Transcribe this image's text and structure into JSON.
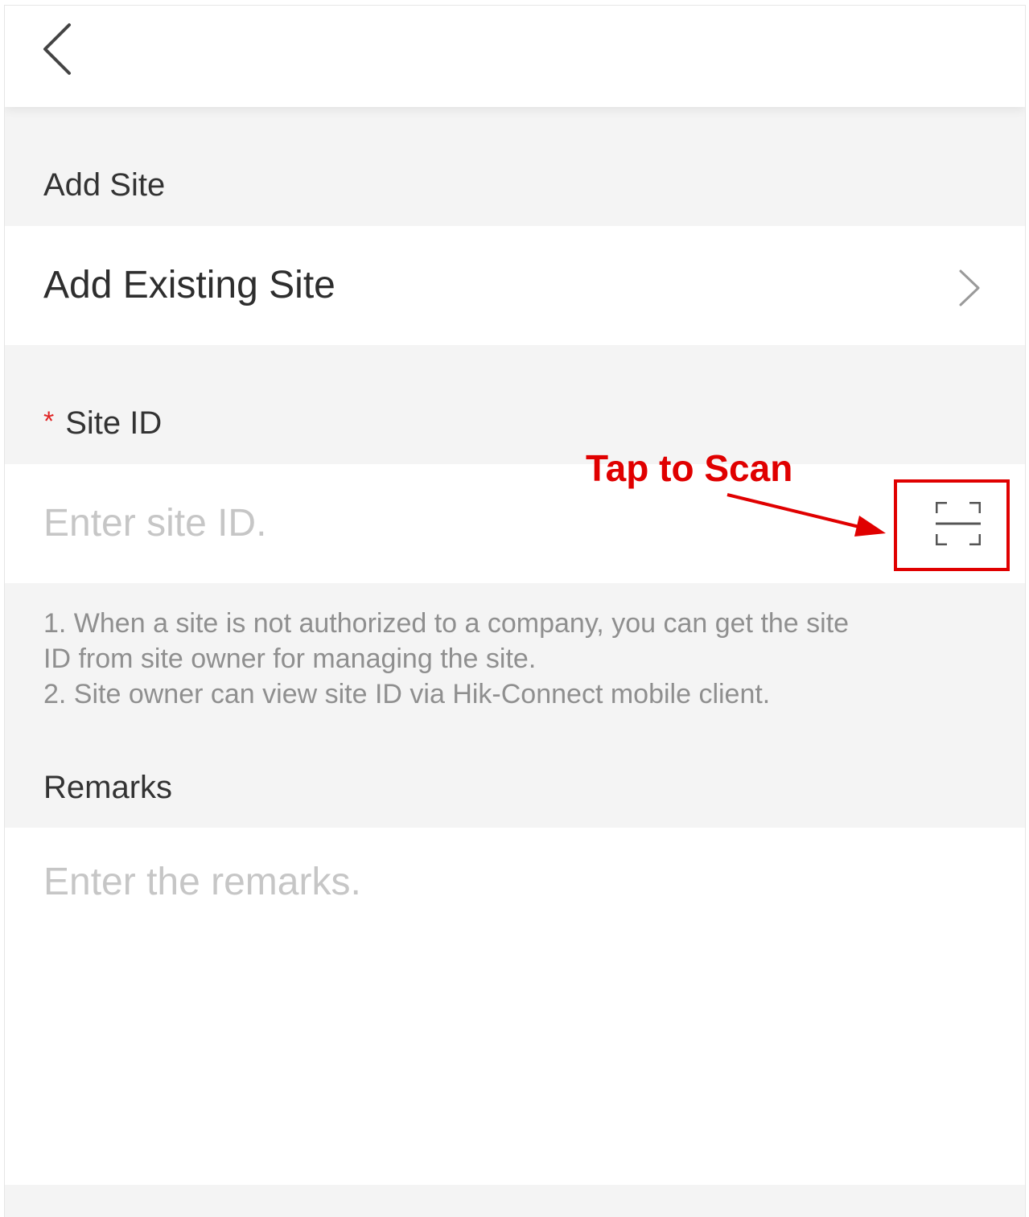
{
  "header": {
    "back_icon": "chevron-left-icon"
  },
  "add_site": {
    "section_label": "Add Site",
    "item_label": "Add Existing Site",
    "item_icon": "chevron-right-icon"
  },
  "site_id": {
    "required_mark": "*",
    "label": "Site ID",
    "placeholder": "Enter site ID.",
    "scan_icon": "scan-frame-icon",
    "hint_lines": [
      "1. When a site is not authorized to a company, you can get the site",
      "ID from site owner for managing the site.",
      "2. Site owner can view site ID via Hik-Connect mobile client."
    ]
  },
  "remarks": {
    "label": "Remarks",
    "placeholder": "Enter the remarks."
  },
  "annotation": {
    "text": "Tap to Scan",
    "color": "#e00000"
  }
}
